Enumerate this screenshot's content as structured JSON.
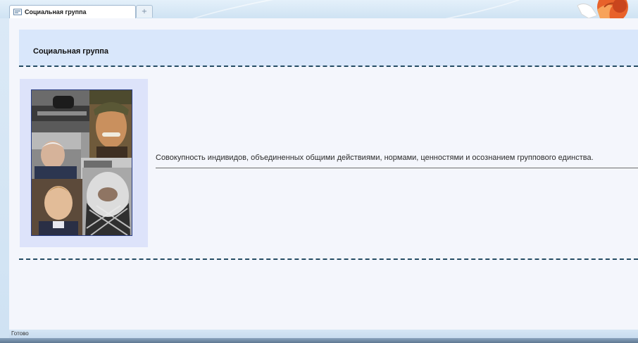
{
  "browser": {
    "tab_title": "Социальная группа",
    "new_tab_symbol": "+",
    "tab_icon": "page-icon",
    "corner_icon": "browser-logo-icon"
  },
  "page": {
    "title": "Социальная группа",
    "definition": "Совокупность индивидов, объединенных общими действиями, нормами, ценностями и осознанием группового единства.",
    "image_subject": "photo-collage-of-people"
  },
  "status": {
    "text": "Готово"
  },
  "colors": {
    "header_band": "#d9e7fb",
    "page_background": "#f4f6fc",
    "dash_line": "#244c64",
    "photo_panel": "#dde3fa",
    "collage_border": "#2b3f86"
  }
}
